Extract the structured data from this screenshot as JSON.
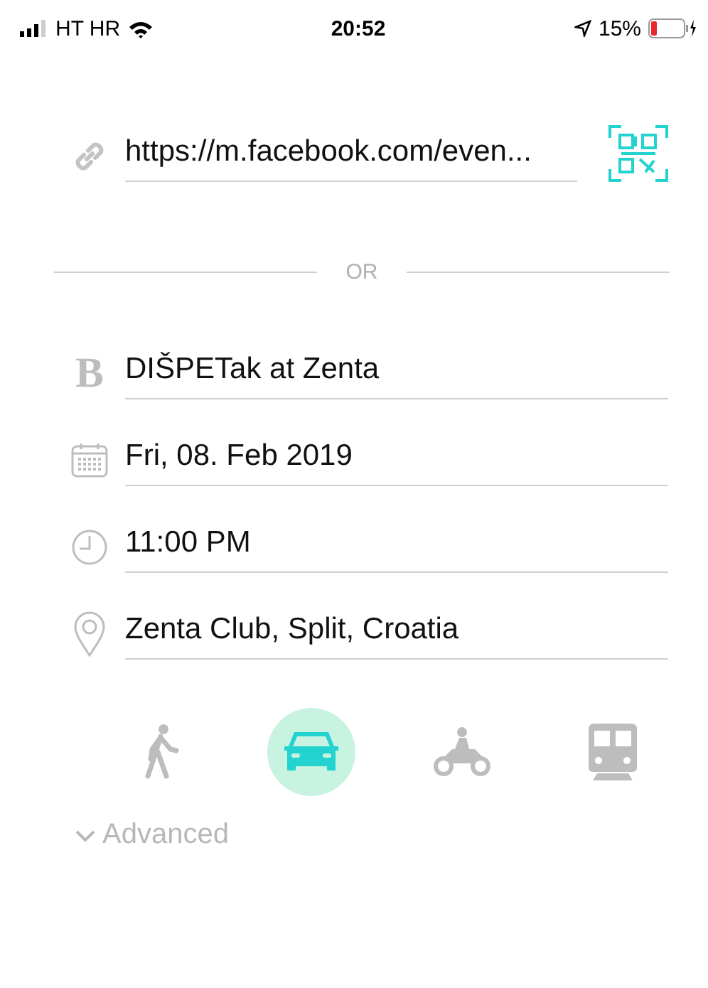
{
  "status_bar": {
    "carrier": "HT HR",
    "time": "20:52",
    "battery": "15%"
  },
  "link": {
    "value": "https://m.facebook.com/even..."
  },
  "divider": {
    "label": "OR"
  },
  "fields": [
    {
      "kind": "title",
      "glyph": "B",
      "value": "DIŠPETak at Zenta"
    },
    {
      "kind": "date",
      "value": "Fri, 08. Feb 2019"
    },
    {
      "kind": "time",
      "value": "11:00 PM"
    },
    {
      "kind": "place",
      "value": "Zenta Club, Split, Croatia"
    }
  ],
  "transport": [
    {
      "kind": "walk",
      "selected": false
    },
    {
      "kind": "car",
      "selected": true
    },
    {
      "kind": "motorbike",
      "selected": false
    },
    {
      "kind": "train",
      "selected": false
    }
  ],
  "advanced": {
    "label": "Advanced",
    "expanded": false
  }
}
